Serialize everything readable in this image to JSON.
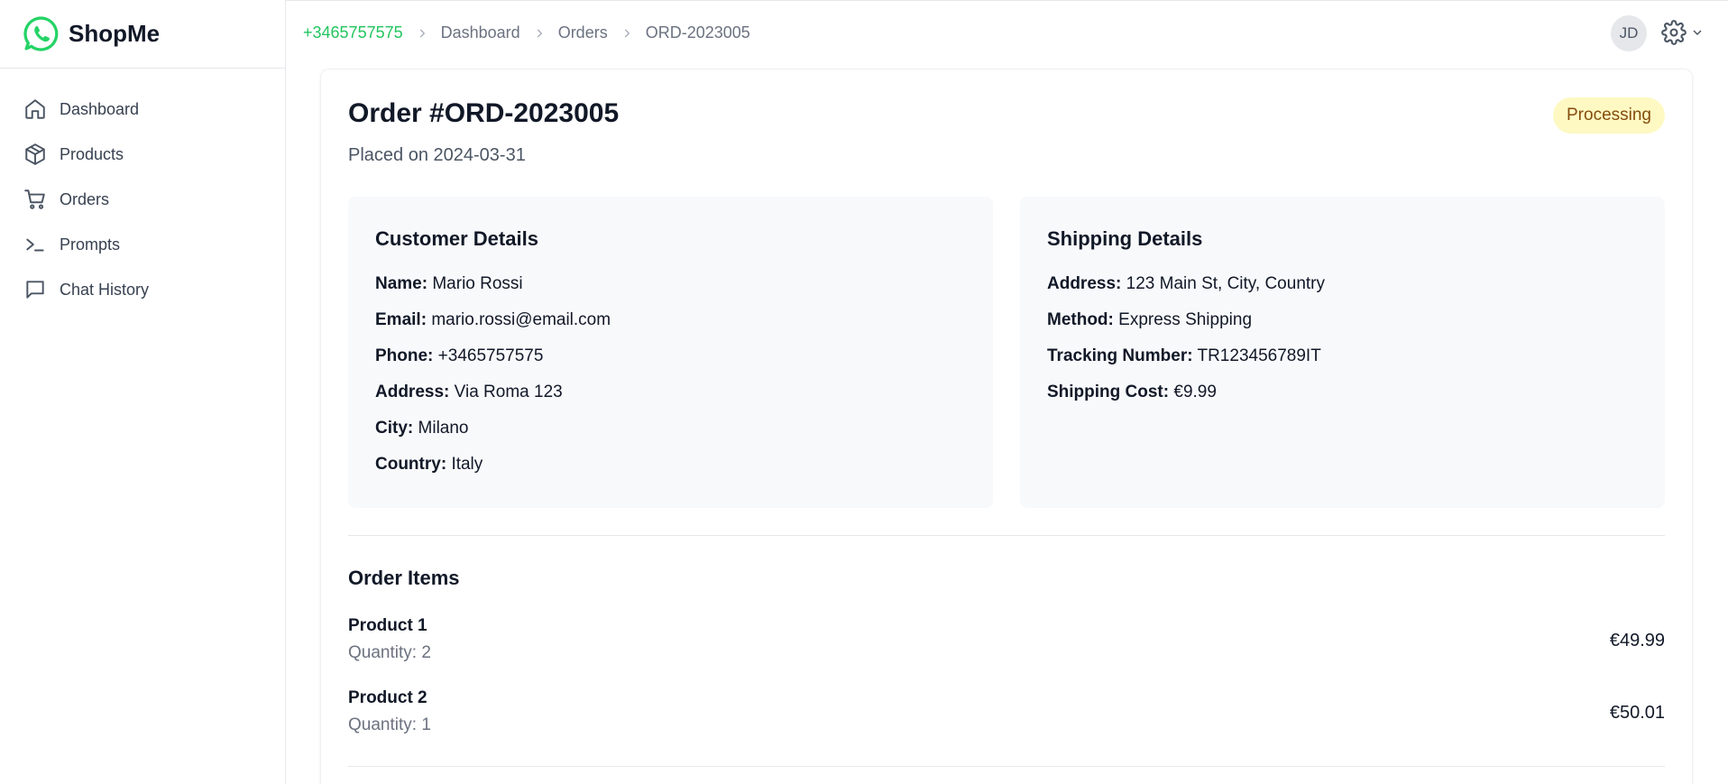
{
  "app": {
    "name": "ShopMe",
    "brand_color": "#25D366"
  },
  "sidebar": {
    "items": [
      {
        "label": "Dashboard",
        "icon": "home-icon"
      },
      {
        "label": "Products",
        "icon": "box-icon"
      },
      {
        "label": "Orders",
        "icon": "cart-icon"
      },
      {
        "label": "Prompts",
        "icon": "terminal-icon"
      },
      {
        "label": "Chat History",
        "icon": "chat-icon"
      }
    ]
  },
  "header": {
    "breadcrumb": [
      "+3465757575",
      "Dashboard",
      "Orders",
      "ORD-2023005"
    ],
    "avatar_initials": "JD"
  },
  "order": {
    "title": "Order #ORD-2023005",
    "placed": "Placed on 2024-03-31",
    "status": "Processing",
    "status_bg": "#fef9c3",
    "status_fg": "#854d0e"
  },
  "customer": {
    "heading": "Customer Details",
    "fields": [
      {
        "label": "Name:",
        "value": "Mario Rossi"
      },
      {
        "label": "Email:",
        "value": "mario.rossi@email.com"
      },
      {
        "label": "Phone:",
        "value": "+3465757575"
      },
      {
        "label": "Address:",
        "value": "Via Roma 123"
      },
      {
        "label": "City:",
        "value": "Milano"
      },
      {
        "label": "Country:",
        "value": "Italy"
      }
    ]
  },
  "shipping": {
    "heading": "Shipping Details",
    "fields": [
      {
        "label": "Address:",
        "value": "123 Main St, City, Country"
      },
      {
        "label": "Method:",
        "value": "Express Shipping"
      },
      {
        "label": "Tracking Number:",
        "value": "TR123456789IT"
      },
      {
        "label": "Shipping Cost:",
        "value": "€9.99"
      }
    ]
  },
  "items": {
    "heading": "Order Items",
    "list": [
      {
        "name": "Product 1",
        "quantity": "Quantity: 2",
        "price": "€49.99"
      },
      {
        "name": "Product 2",
        "quantity": "Quantity: 1",
        "price": "€50.01"
      }
    ]
  }
}
